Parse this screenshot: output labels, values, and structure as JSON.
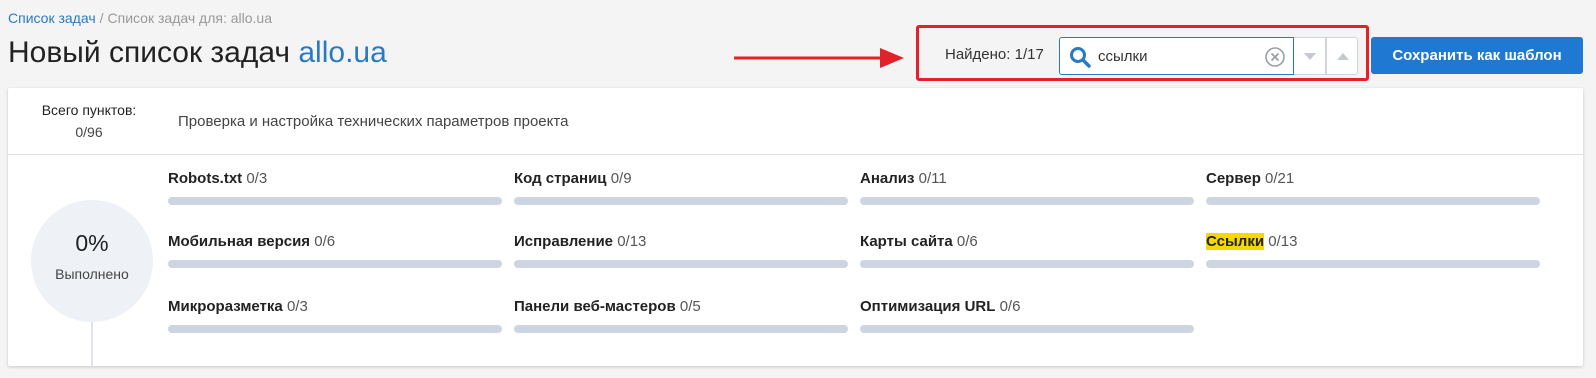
{
  "breadcrumb": {
    "link": "Список задач",
    "separator": "/",
    "current": "Список задач для: allo.ua"
  },
  "title": {
    "text": "Новый список задач",
    "site": "allo.ua"
  },
  "search": {
    "found": "Найдено: 1/17",
    "value": "ссылки"
  },
  "save_button": "Сохранить как шаблон",
  "summary": {
    "total_label": "Всего пунктов:",
    "total_value": "0/96",
    "description": "Проверка и настройка технических параметров проекта",
    "percent": "0%",
    "done_label": "Выполнено"
  },
  "categories": [
    {
      "name": "Robots.txt",
      "count": "0/3",
      "progress": 0
    },
    {
      "name": "Код страниц",
      "count": "0/9",
      "progress": 0
    },
    {
      "name": "Анализ",
      "count": "0/11",
      "progress": 0
    },
    {
      "name": "Сервер",
      "count": "0/21",
      "progress": 0
    },
    {
      "name": "Мобильная версия",
      "count": "0/6",
      "progress": 0
    },
    {
      "name": "Исправление",
      "count": "0/13",
      "progress": 0
    },
    {
      "name": "Карты сайта",
      "count": "0/6",
      "progress": 0
    },
    {
      "name": "Ссылки",
      "count": "0/13",
      "progress": 0,
      "highlighted": true
    },
    {
      "name": "Микроразметка",
      "count": "0/3",
      "progress": 0
    },
    {
      "name": "Панели веб-мастеров",
      "count": "0/5",
      "progress": 0
    },
    {
      "name": "Оптимизация URL",
      "count": "0/6",
      "progress": 0
    }
  ],
  "colors": {
    "accent": "#1f78d1",
    "annotation_red": "#e32128",
    "highlight": "#f5d800",
    "bar_track": "#cdd5e2"
  }
}
